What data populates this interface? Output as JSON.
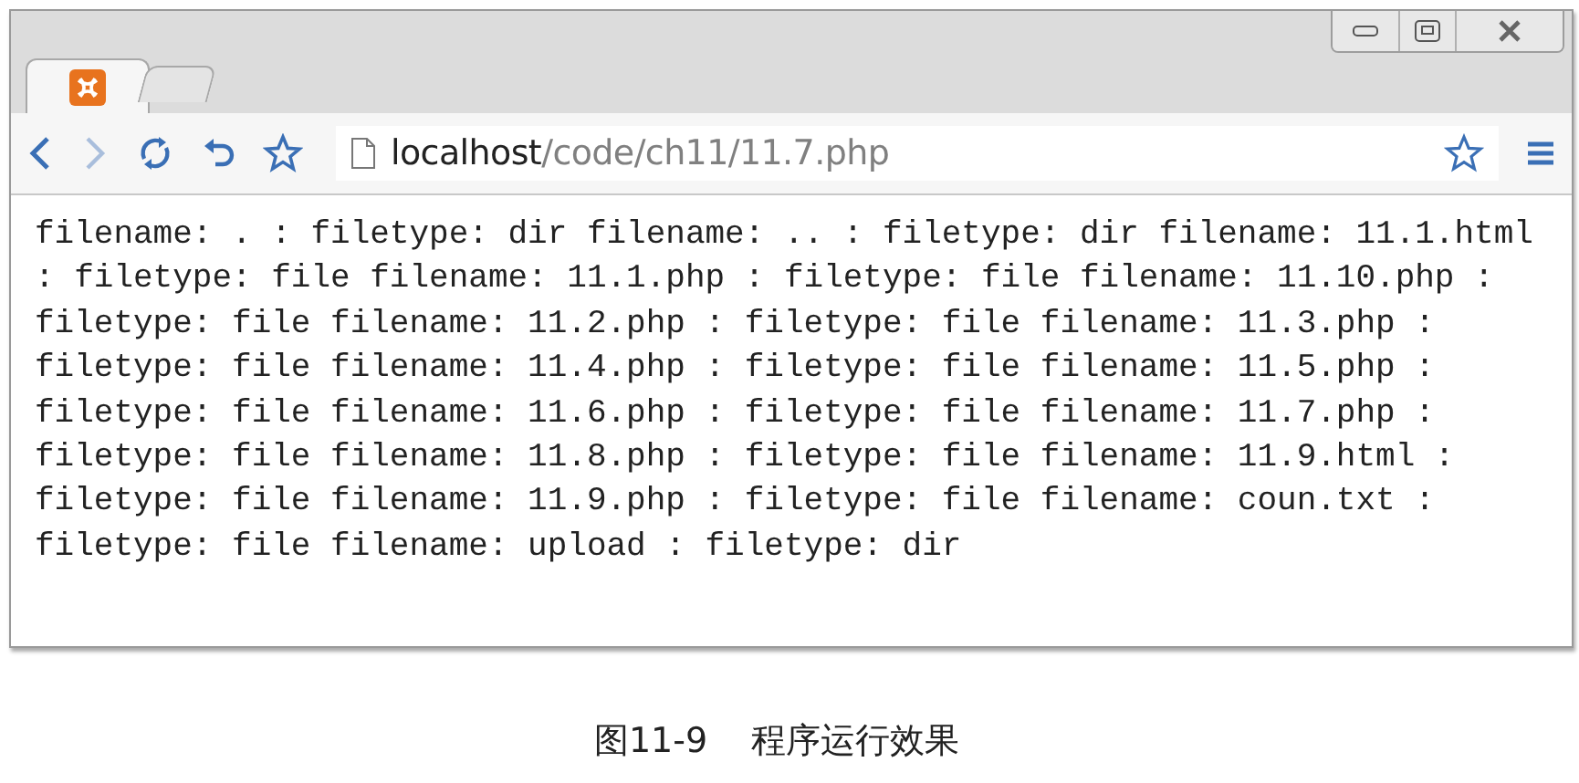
{
  "window": {
    "tabs": [
      {
        "selected": true,
        "kind": "app"
      },
      {
        "selected": false,
        "kind": "new"
      }
    ]
  },
  "address_bar": {
    "host": "localhost",
    "path": "/code/ch11/11.7.php"
  },
  "content": {
    "lines": [
      "filename: . : filetype: dir filename: .. : filetype: dir filename: 11.1.html",
      ": filetype: file filename: 11.1.php : filetype: file filename: 11.10.php :",
      "filetype: file filename: 11.2.php : filetype: file filename: 11.3.php :",
      "filetype: file filename: 11.4.php : filetype: file filename: 11.5.php :",
      "filetype: file filename: 11.6.php : filetype: file filename: 11.7.php :",
      "filetype: file filename: 11.8.php : filetype: file filename: 11.9.html :",
      "filetype: file filename: 11.9.php : filetype: file filename: coun.txt :",
      "filetype: file filename: upload : filetype: dir"
    ]
  },
  "caption": {
    "label": "图11-9",
    "text": "程序运行效果"
  }
}
